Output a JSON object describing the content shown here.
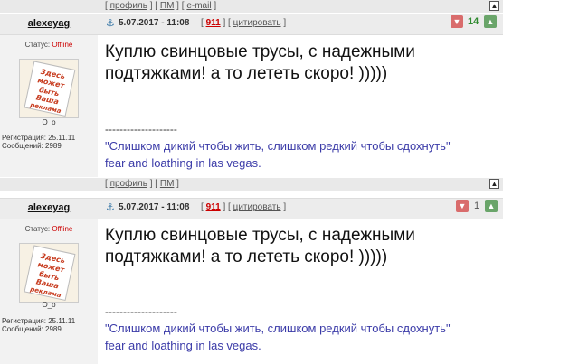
{
  "footer_links": {
    "profile": "профиль",
    "pm": "ПМ",
    "email": "e-mail",
    "to_top": "▲"
  },
  "posts": [
    {
      "username": "alexeyag",
      "status_label": "Статус:",
      "status_value": "Offline",
      "nickname": "O_o",
      "registration": "Регистрация: 25.11.11",
      "messages": "Сообщений: 2989",
      "date": "5.07.2017 - 11:08",
      "post_number": "911",
      "quote_label": "цитировать",
      "rating": "14",
      "rating_color": "#2f8a2f",
      "text": "Куплю свинцовые трусы, с надежными подтяжками! а то лететь скоро! )))))",
      "sig_dashes": "--------------------",
      "signature_line1": "\"Слишком дикий чтобы жить, слишком редкий чтобы сдохнуть\"",
      "signature_line2": "fear and loathing in las vegas.",
      "avatar_text": "Здесь может быть Ваша реклама"
    },
    {
      "username": "alexeyag",
      "status_label": "Статус:",
      "status_value": "Offline",
      "nickname": "O_o",
      "registration": "Регистрация: 25.11.11",
      "messages": "Сообщений: 2989",
      "date": "5.07.2017 - 11:08",
      "post_number": "911",
      "quote_label": "цитировать",
      "rating": "1",
      "rating_color": "#555555",
      "text": "Куплю свинцовые трусы, с надежными подтяжками! а то лететь скоро! )))))",
      "sig_dashes": "--------------------",
      "signature_line1": "\"Слишком дикий чтобы жить, слишком редкий чтобы сдохнуть\"",
      "signature_line2": "fear and loathing in las vegas.",
      "avatar_text": "Здесь может быть Ваша реклама"
    }
  ]
}
